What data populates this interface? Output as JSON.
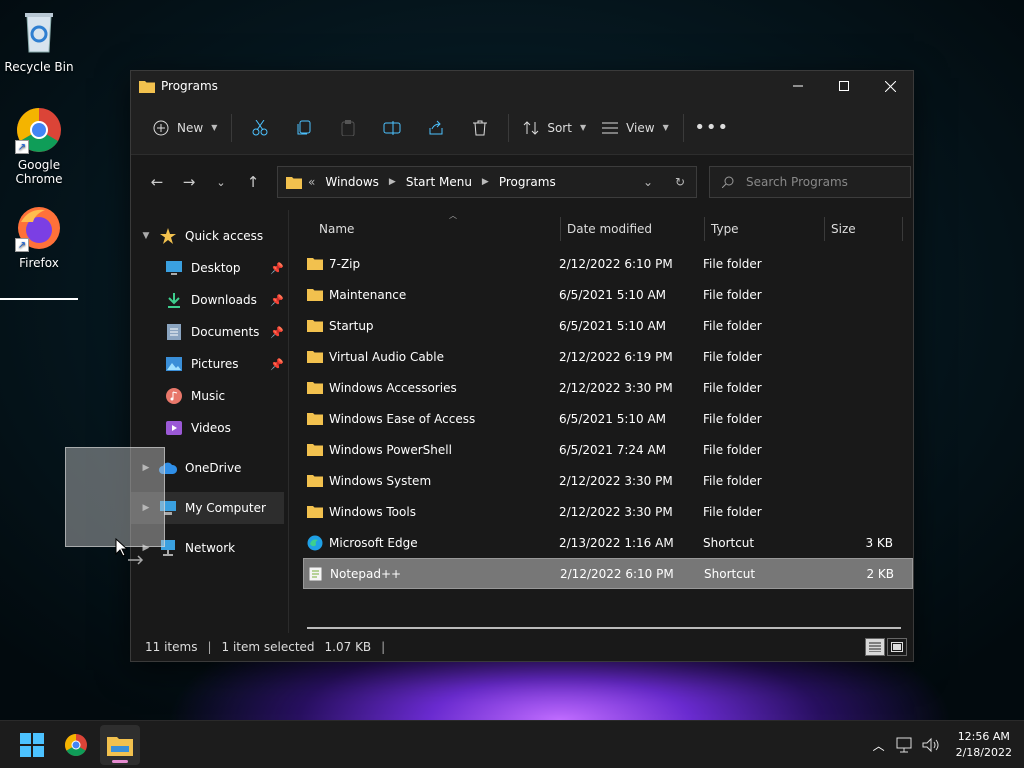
{
  "desktop": {
    "icons": [
      {
        "label": "Recycle Bin"
      },
      {
        "label": "Google Chrome"
      },
      {
        "label": "Firefox"
      }
    ]
  },
  "window": {
    "title": "Programs",
    "toolbar": {
      "new_label": "New",
      "sort_label": "Sort",
      "view_label": "View"
    },
    "address": {
      "overflow": "«",
      "crumbs": [
        "Windows",
        "Start Menu",
        "Programs"
      ],
      "search_placeholder": "Search Programs"
    },
    "nav": {
      "quick_access": "Quick access",
      "items": [
        {
          "label": "Desktop",
          "pinned": true
        },
        {
          "label": "Downloads",
          "pinned": true
        },
        {
          "label": "Documents",
          "pinned": true
        },
        {
          "label": "Pictures",
          "pinned": true
        },
        {
          "label": "Music",
          "pinned": false
        },
        {
          "label": "Videos",
          "pinned": false
        }
      ],
      "onedrive": "OneDrive",
      "my_computer": "My Computer",
      "network": "Network"
    },
    "columns": {
      "name": "Name",
      "date": "Date modified",
      "type": "Type",
      "size": "Size"
    },
    "files": [
      {
        "name": "7-Zip",
        "date": "2/12/2022 6:10 PM",
        "type": "File folder",
        "size": "",
        "icon": "folder"
      },
      {
        "name": "Maintenance",
        "date": "6/5/2021 5:10 AM",
        "type": "File folder",
        "size": "",
        "icon": "folder"
      },
      {
        "name": "Startup",
        "date": "6/5/2021 5:10 AM",
        "type": "File folder",
        "size": "",
        "icon": "folder"
      },
      {
        "name": "Virtual Audio Cable",
        "date": "2/12/2022 6:19 PM",
        "type": "File folder",
        "size": "",
        "icon": "folder"
      },
      {
        "name": "Windows Accessories",
        "date": "2/12/2022 3:30 PM",
        "type": "File folder",
        "size": "",
        "icon": "folder"
      },
      {
        "name": "Windows Ease of Access",
        "date": "6/5/2021 5:10 AM",
        "type": "File folder",
        "size": "",
        "icon": "folder"
      },
      {
        "name": "Windows PowerShell",
        "date": "6/5/2021 7:24 AM",
        "type": "File folder",
        "size": "",
        "icon": "folder"
      },
      {
        "name": "Windows System",
        "date": "2/12/2022 3:30 PM",
        "type": "File folder",
        "size": "",
        "icon": "folder"
      },
      {
        "name": "Windows Tools",
        "date": "2/12/2022 3:30 PM",
        "type": "File folder",
        "size": "",
        "icon": "folder"
      },
      {
        "name": "Microsoft Edge",
        "date": "2/13/2022 1:16 AM",
        "type": "Shortcut",
        "size": "3 KB",
        "icon": "edge"
      },
      {
        "name": "Notepad++",
        "date": "2/12/2022 6:10 PM",
        "type": "Shortcut",
        "size": "2 KB",
        "icon": "notepad",
        "selected": true
      }
    ],
    "status": {
      "items": "11 items",
      "selected": "1 item selected",
      "size": "1.07 KB",
      "sep": "|"
    }
  },
  "taskbar": {
    "time": "12:56 AM",
    "date": "2/18/2022"
  },
  "colors": {
    "folder": "#f2c14e",
    "accent": "#4cc2ff",
    "selected_row": "#777777"
  }
}
